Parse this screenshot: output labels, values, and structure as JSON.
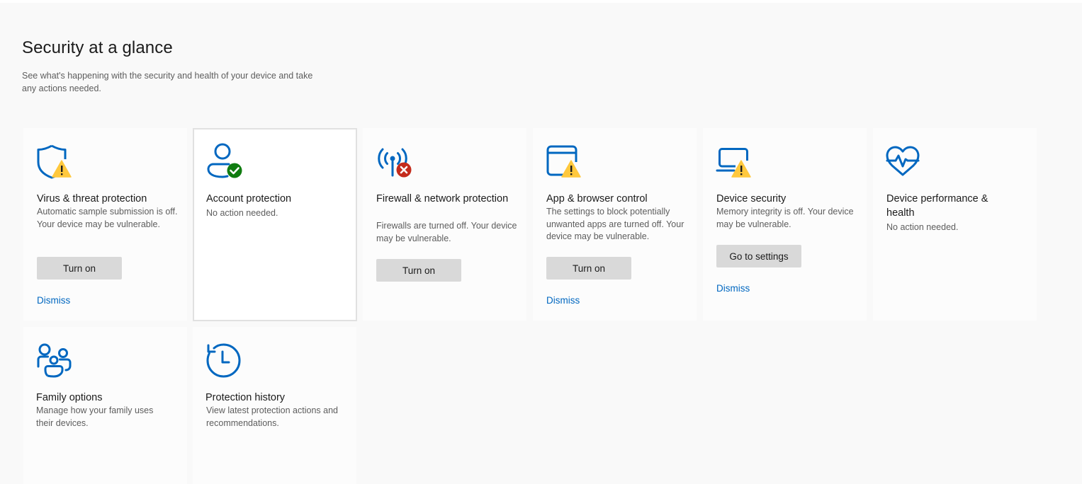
{
  "header": {
    "title": "Security at a glance",
    "subtitle": "See what's happening with the security and health of your device and take any actions needed."
  },
  "colors": {
    "accent": "#0067c0",
    "warning": "#ffc83d",
    "success": "#107c10",
    "error": "#c42b1c"
  },
  "tiles": [
    {
      "title": "Virus & threat protection",
      "description": "Automatic sample submission is off. Your device may be vulnerable.",
      "button": "Turn on",
      "link": "Dismiss",
      "icon": "shield-icon",
      "status": "warning"
    },
    {
      "title": "Account protection",
      "description": "No action needed.",
      "icon": "person-icon",
      "status": "ok"
    },
    {
      "title": "Firewall & network protection",
      "description": "Firewalls are turned off. Your device may be vulnerable.",
      "button": "Turn on",
      "icon": "antenna-icon",
      "status": "error"
    },
    {
      "title": "App & browser control",
      "description": "The settings to block potentially unwanted apps are turned off. Your device may be vulnerable.",
      "button": "Turn on",
      "link": "Dismiss",
      "icon": "browser-window-icon",
      "status": "warning"
    },
    {
      "title": "Device security",
      "description": "Memory integrity is off. Your device may be vulnerable.",
      "button": "Go to settings",
      "link": "Dismiss",
      "icon": "laptop-icon",
      "status": "warning"
    },
    {
      "title": "Device performance & health",
      "description": "No action needed.",
      "icon": "heartbeat-icon",
      "status": "ok"
    },
    {
      "title": "Family options",
      "description": "Manage how your family uses their devices.",
      "icon": "family-icon",
      "status": "none"
    },
    {
      "title": "Protection history",
      "description": "View latest protection actions and recommendations.",
      "icon": "history-icon",
      "status": "none"
    }
  ]
}
